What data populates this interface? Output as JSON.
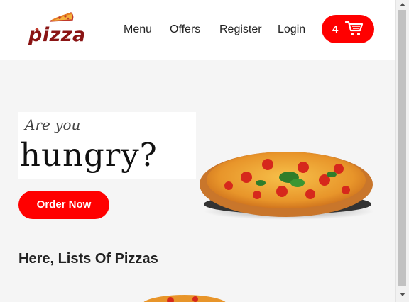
{
  "header": {
    "logo_text": "pizza",
    "logo_icon": "pizza-slice-icon",
    "nav": [
      {
        "label": "Menu"
      },
      {
        "label": "Offers"
      },
      {
        "label": "Register"
      },
      {
        "label": "Login"
      }
    ],
    "cart": {
      "count": "4",
      "icon": "shopping-cart-icon"
    }
  },
  "hero": {
    "tagline_small": "Are you",
    "tagline_big": "hungry?",
    "cta_label": "Order Now"
  },
  "section": {
    "title": "Here, Lists Of Pizzas"
  },
  "colors": {
    "accent": "#ff0000",
    "logo": "#8a1414",
    "background": "#f5f5f5"
  }
}
